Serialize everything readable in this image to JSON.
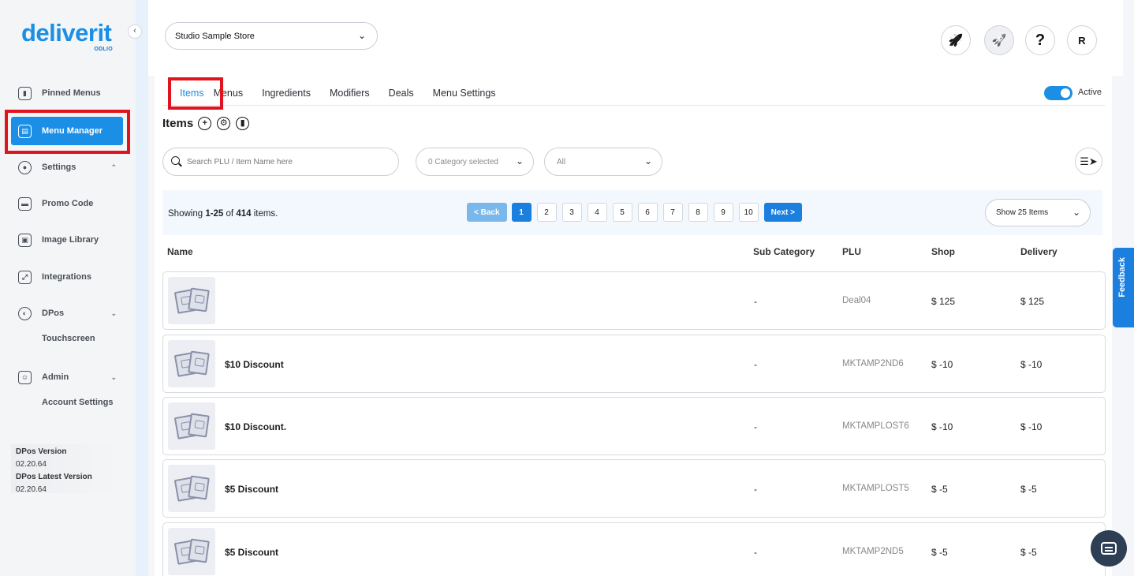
{
  "brand": {
    "logo_text": "deliverit",
    "logo_sub": "ODLIO"
  },
  "sidebar": {
    "collapse_glyph": "‹",
    "items": [
      {
        "label": "Pinned Menus",
        "icon": "bookmark-icon"
      },
      {
        "label": "Menu Manager",
        "icon": "menu-book-icon"
      },
      {
        "label": "Settings",
        "icon": "gear-icon"
      },
      {
        "label": "Promo Code",
        "icon": "ticket-icon"
      },
      {
        "label": "Image Library",
        "icon": "image-icon"
      },
      {
        "label": "Integrations",
        "icon": "plug-icon"
      },
      {
        "label": "DPos",
        "icon": "pos-icon"
      },
      {
        "label": "Admin",
        "icon": "user-icon"
      }
    ],
    "subitems": {
      "touchscreen": "Touchscreen",
      "account_settings": "Account Settings"
    },
    "version": {
      "dpos_label": "DPos Version",
      "dpos_value": "02.20.64",
      "latest_label": "DPos Latest Version",
      "latest_value": "02.20.64"
    }
  },
  "header": {
    "store": "Studio Sample Store",
    "buttons": [
      {
        "name": "rocket-icon",
        "glyph": "🚀"
      },
      {
        "name": "launch-icon",
        "glyph": "🚀"
      },
      {
        "name": "help-icon",
        "glyph": "?"
      },
      {
        "name": "avatar",
        "glyph": "R"
      }
    ]
  },
  "tabs": [
    "Items",
    "Menus",
    "Ingredients",
    "Modifiers",
    "Deals",
    "Menu Settings"
  ],
  "active_toggle": {
    "label": "Active",
    "on": true
  },
  "items_section": {
    "title": "Items",
    "search_placeholder": "Search PLU / Item Name here",
    "category_dd": "0 Category selected",
    "status_dd": "All"
  },
  "pagination": {
    "showing_prefix": "Showing ",
    "range": "1-25",
    "of": " of ",
    "total": "414",
    "suffix": " items.",
    "back": "< Back",
    "pages": [
      "1",
      "2",
      "3",
      "4",
      "5",
      "6",
      "7",
      "8",
      "9",
      "10"
    ],
    "next": "Next >",
    "show_select": "Show 25 Items"
  },
  "table": {
    "headers": {
      "name": "Name",
      "sub": "Sub Category",
      "plu": "PLU",
      "shop": "Shop",
      "delivery": "Delivery"
    },
    "rows": [
      {
        "name": "",
        "sub": "-",
        "plu": "Deal04",
        "shop": "$ 125",
        "delivery": "$ 125"
      },
      {
        "name": "$10 Discount",
        "sub": "-",
        "plu": "MKTAMP2ND6",
        "shop": "$ -10",
        "delivery": "$ -10"
      },
      {
        "name": "$10 Discount.",
        "sub": "-",
        "plu": "MKTAMPLOST6",
        "shop": "$ -10",
        "delivery": "$ -10"
      },
      {
        "name": "$5 Discount",
        "sub": "-",
        "plu": "MKTAMPLOST5",
        "shop": "$ -5",
        "delivery": "$ -5"
      },
      {
        "name": "$5 Discount",
        "sub": "-",
        "plu": "MKTAMP2ND5",
        "shop": "$ -5",
        "delivery": "$ -5"
      }
    ]
  },
  "feedback": "Feedback",
  "colors": {
    "accent": "#1b8fe6",
    "highlight": "#e0141e"
  }
}
